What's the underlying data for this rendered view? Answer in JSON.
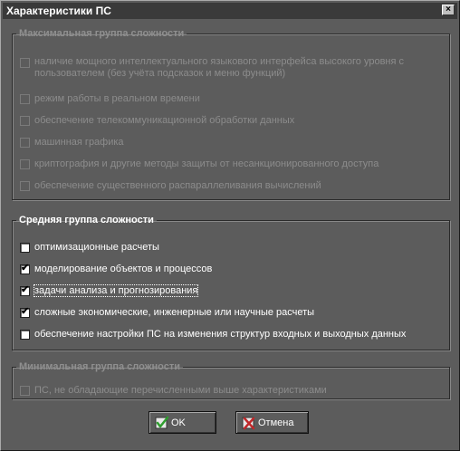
{
  "window": {
    "title": "Характеристики ПС",
    "close_glyph": "×"
  },
  "groups": [
    {
      "legend": "Максимальная группа сложности",
      "enabled": false,
      "items": [
        {
          "label_line1": "наличие мощного интеллектуального языкового интерфейса высокого уровня с",
          "label_line2": "пользователем (без учёта подсказок и меню функций)",
          "checked": false
        },
        {
          "label": "режим работы в реальном времени",
          "checked": false
        },
        {
          "label": "обеспечение телекоммуникационной обработки данных",
          "checked": false
        },
        {
          "label": "машинная графика",
          "checked": false
        },
        {
          "label": "криптография и другие методы защиты от несанкционированного доступа",
          "checked": false
        },
        {
          "label": "обеспечение существенного распараллеливания вычислений",
          "checked": false
        }
      ]
    },
    {
      "legend": "Средняя группа сложности",
      "enabled": true,
      "items": [
        {
          "label": "оптимизационные расчеты",
          "checked": false
        },
        {
          "label": "моделирование объектов и процессов",
          "checked": true
        },
        {
          "label": "задачи анализа и прогнозирования",
          "checked": true,
          "focused": true
        },
        {
          "label": "сложные экономические, инженерные или научные расчеты",
          "checked": true
        },
        {
          "label": "обеспечение настройки ПС на изменения структур входных и выходных данных",
          "checked": false
        }
      ]
    },
    {
      "legend": "Минимальная группа сложности",
      "enabled": false,
      "items": [
        {
          "label": "ПС, не обладающие перечисленными выше характеристиками",
          "checked": false
        }
      ]
    }
  ],
  "buttons": {
    "ok": "OK",
    "cancel": "Отмена"
  },
  "colors": {
    "ok_icon": "#2e9e2e",
    "cancel_icon": "#c0282a"
  }
}
